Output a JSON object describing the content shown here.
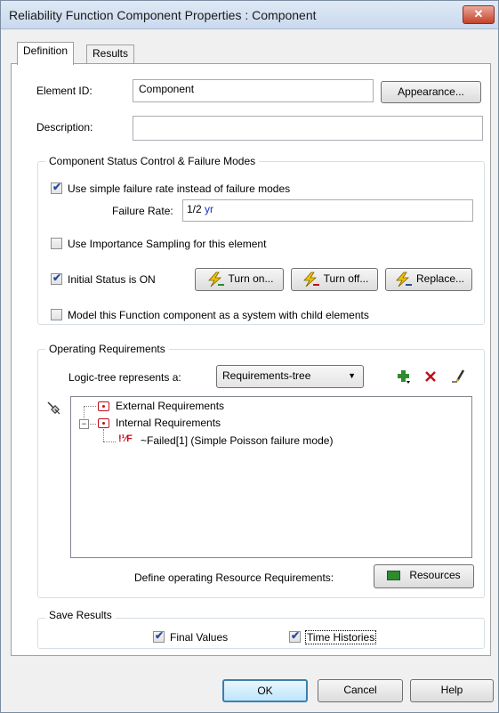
{
  "window": {
    "title": "Reliability Function Component Properties : Component",
    "close_symbol": "✕"
  },
  "tabs": [
    {
      "label": "Definition"
    },
    {
      "label": "Results"
    }
  ],
  "definition": {
    "element_id_label": "Element ID:",
    "element_id_value": "Component",
    "appearance_button": "Appearance...",
    "description_label": "Description:",
    "description_value": ""
  },
  "status_group": {
    "title": "Component Status Control & Failure Modes",
    "simple_failure_rate_label": "Use simple failure rate instead of failure modes",
    "simple_failure_rate_checked": true,
    "failure_rate_label": "Failure Rate:",
    "failure_rate_value": "1/2",
    "failure_rate_unit": "yr",
    "importance_sampling_label": "Use Importance Sampling for this element",
    "importance_sampling_checked": false,
    "initial_status_label": "Initial Status is ON",
    "initial_status_checked": true,
    "turn_on_button": "Turn on...",
    "turn_off_button": "Turn off...",
    "replace_button": "Replace...",
    "model_as_system_label": "Model this Function component as a system with child elements",
    "model_as_system_checked": false
  },
  "operating_group": {
    "title": "Operating Requirements",
    "logic_tree_label": "Logic-tree represents a:",
    "logic_tree_value": "Requirements-tree",
    "tree": {
      "external": "External Requirements",
      "internal": "Internal Requirements",
      "failed_icon": "!¹⁄F",
      "failed": "~Failed[1]  (Simple Poisson failure mode)"
    },
    "resources_label": "Define operating Resource Requirements:",
    "resources_button": "Resources"
  },
  "save_group": {
    "title": "Save Results",
    "final_values_label": "Final Values",
    "final_values_checked": true,
    "time_histories_label": "Time Histories",
    "time_histories_checked": true
  },
  "footer": {
    "ok": "OK",
    "cancel": "Cancel",
    "help": "Help"
  },
  "icons": {
    "accent": "#2a4c9c",
    "bolt_color": "#f2c200",
    "add_color": "#2e8b2e",
    "delete_color": "#c0101a"
  }
}
